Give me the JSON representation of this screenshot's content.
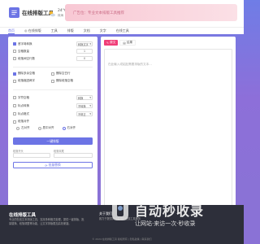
{
  "header": {
    "logo_text": "在线排版工具",
    "weather": {
      "temp": "24°C 晴",
      "city": "珠海"
    },
    "banner_text": "广告位：专业文本排版工具推荐"
  },
  "nav": {
    "items": [
      "首页",
      "◎ 在线排版",
      "工具",
      "排版",
      "文档",
      "文字",
      "在线工具"
    ]
  },
  "options": {
    "opt1": {
      "label": "首字母转换",
      "value": "转换文字"
    },
    "opt2": {
      "label": "空格数量",
      "value": "1"
    },
    "opt3": {
      "label": "段落间空行数",
      "value": "0"
    },
    "cb1": "删除多余空格",
    "cb2": "删除空白行",
    "cb3": "段落缩进两字",
    "cb4": "删除段落空格",
    "sel1": {
      "label": "字符空格",
      "value": "转换"
    },
    "sel2": {
      "label": "标点转换",
      "value": "不转换"
    },
    "sel3": {
      "label": "标点格式",
      "value": "不修正"
    },
    "radio_label": "段落对齐",
    "radios": [
      "左对齐",
      "居中对齐",
      "右对齐"
    ],
    "primary_button": "一键排版",
    "field1_label": "段落开头",
    "field2_label": "段落末尾",
    "outline_button": "批量替换"
  },
  "editor": {
    "tab_active": "原文",
    "tab_inactive": "结果",
    "placeholder": "在此输入或粘贴需要排版的文本..."
  },
  "footer": {
    "title": "在线排版工具",
    "desc": "专业的在线文本排版工具，支持多种格式处理，提供一键排版、批量替换、段落调整等功能，让文字排版更加高效便捷。",
    "about_title": "关于我们",
    "about_text": "致力于提供简洁实用的在线工具服务",
    "copyright": "© 2024 在线排版工具 版权所有 | 隐私政策 | 联系我们"
  },
  "watermark": {
    "main": "自动秒收录",
    "sub": "让网站·来访一次·秒收录"
  },
  "colors": {
    "accent": "#6c74e5",
    "tab_active": "#f03e78"
  }
}
